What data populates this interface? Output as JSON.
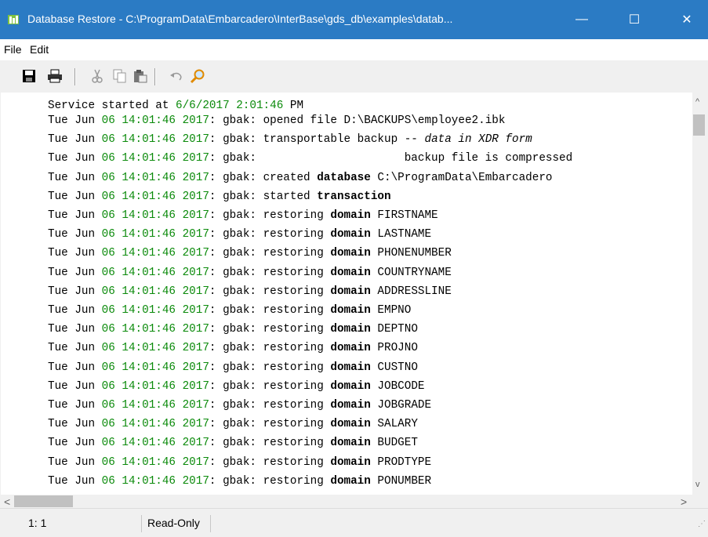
{
  "window": {
    "title": "Database Restore - C:\\ProgramData\\Embarcadero\\InterBase\\gds_db\\examples\\datab...",
    "minimize": "—",
    "maximize": "☐",
    "close": "✕"
  },
  "menu": {
    "file": "File",
    "edit": "Edit"
  },
  "toolbar": {
    "icons": [
      "save-icon",
      "print-icon",
      "cut-icon",
      "copy-icon",
      "paste-icon",
      "undo-icon",
      "find-icon"
    ]
  },
  "log": {
    "header": {
      "prefix": "Service started at ",
      "date": "6/6/2017 2:01:46",
      "suffix": " PM"
    },
    "line_prefix_day": "Tue Jun ",
    "line_datetime": "06 14:01:46 2017",
    "line_sep": ": gbak: ",
    "lines": [
      {
        "a": "opened file ",
        "b": "",
        "c": "D:\\BACKUPS\\employee2.ibk"
      },
      {
        "a": "transportable backup -- ",
        "b": "",
        "c": "data in XDR form"
      },
      {
        "a": "                     backup file is compressed",
        "b": "",
        "c": ""
      },
      {
        "a": "created ",
        "b": "database",
        "c": " C:\\ProgramData\\Embarcadero"
      },
      {
        "a": "started ",
        "b": "transaction",
        "c": ""
      },
      {
        "a": "restoring ",
        "b": "domain",
        "c": " FIRSTNAME"
      },
      {
        "a": "restoring ",
        "b": "domain",
        "c": " LASTNAME"
      },
      {
        "a": "restoring ",
        "b": "domain",
        "c": " PHONENUMBER"
      },
      {
        "a": "restoring ",
        "b": "domain",
        "c": " COUNTRYNAME"
      },
      {
        "a": "restoring ",
        "b": "domain",
        "c": " ADDRESSLINE"
      },
      {
        "a": "restoring ",
        "b": "domain",
        "c": " EMPNO"
      },
      {
        "a": "restoring ",
        "b": "domain",
        "c": " DEPTNO"
      },
      {
        "a": "restoring ",
        "b": "domain",
        "c": " PROJNO"
      },
      {
        "a": "restoring ",
        "b": "domain",
        "c": " CUSTNO"
      },
      {
        "a": "restoring ",
        "b": "domain",
        "c": " JOBCODE"
      },
      {
        "a": "restoring ",
        "b": "domain",
        "c": " JOBGRADE"
      },
      {
        "a": "restoring ",
        "b": "domain",
        "c": " SALARY"
      },
      {
        "a": "restoring ",
        "b": "domain",
        "c": " BUDGET"
      },
      {
        "a": "restoring ",
        "b": "domain",
        "c": " PRODTYPE"
      },
      {
        "a": "restoring ",
        "b": "domain",
        "c": " PONUMBER"
      }
    ]
  },
  "status": {
    "position": "1: 1",
    "mode": "Read-Only"
  },
  "colors": {
    "titlebar": "#2b7bc4",
    "number": "#0a8a0a"
  }
}
